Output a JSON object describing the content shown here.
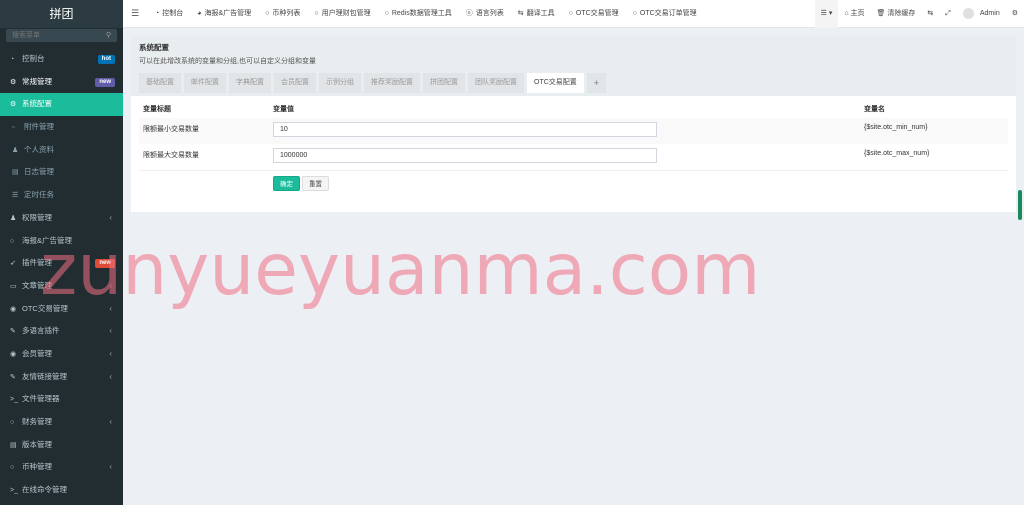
{
  "sidebar": {
    "logo": "拼团",
    "search_placeholder": "搜索菜单",
    "items": [
      {
        "label": "控制台",
        "badge": "hot",
        "badge_color": "#0073b7"
      },
      {
        "label": "常规管理",
        "badge": "new",
        "badge_color": "#605ca8"
      },
      {
        "label": "系统配置"
      },
      {
        "label": "附件管理"
      },
      {
        "label": "个人资料"
      },
      {
        "label": "日志管理"
      },
      {
        "label": "定时任务"
      },
      {
        "label": "权限管理",
        "chevron": "‹"
      },
      {
        "label": "海报&广告管理"
      },
      {
        "label": "插件管理",
        "badge": "new",
        "badge_color": "#dd4b39"
      },
      {
        "label": "文章管理",
        "chevron": "‹"
      },
      {
        "label": "OTC交易管理",
        "chevron": "‹"
      },
      {
        "label": "多语言插件",
        "chevron": "‹"
      },
      {
        "label": "会员管理",
        "chevron": "‹"
      },
      {
        "label": "友情链接管理",
        "chevron": "‹"
      },
      {
        "label": "文件管理器"
      },
      {
        "label": "财务管理",
        "chevron": "‹"
      },
      {
        "label": "版本管理"
      },
      {
        "label": "币种管理",
        "chevron": "‹"
      },
      {
        "label": "在线命令管理"
      }
    ]
  },
  "header": {
    "nav": [
      "控制台",
      "海报&广告管理",
      "币种列表",
      "用户理财包管理",
      "Redis数据管理工具",
      "语言列表",
      "翻译工具",
      "OTC交易管理",
      "OTC交易订单管理"
    ],
    "home": "主页",
    "clear_cache": "清除缓存",
    "user": "Admin"
  },
  "panel": {
    "title": "系统配置",
    "subtitle": "可以在此增改系统的变量和分组,也可以自定义分组和变量",
    "tabs": [
      "基础配置",
      "邮件配置",
      "字典配置",
      "会员配置",
      "示例分组",
      "推荐奖励配置",
      "拼团配置",
      "团队奖励配置",
      "OTC交易配置"
    ],
    "add_tab": "+",
    "columns": {
      "title": "变量标题",
      "value": "变量值",
      "name": "变量名"
    },
    "rows": [
      {
        "title": "限额最小交易数量",
        "value": "10",
        "name": "{$site.otc_min_num}"
      },
      {
        "title": "限额最大交易数量",
        "value": "1000000",
        "name": "{$site.otc_max_num}"
      }
    ],
    "ok_label": "确定",
    "reset_label": "重置"
  },
  "watermark": "zunyueyuanma.com"
}
